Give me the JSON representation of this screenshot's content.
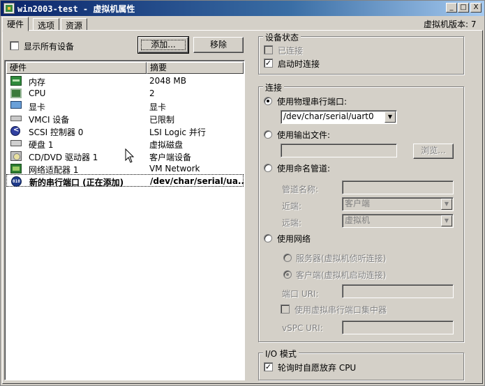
{
  "window": {
    "title": "win2003-test - 虚拟机属性",
    "minimize": "_",
    "maximize": "□",
    "close": "X"
  },
  "tabs": [
    {
      "label": "硬件",
      "active": true
    },
    {
      "label": "选项",
      "active": false
    },
    {
      "label": "资源",
      "active": false
    }
  ],
  "version_label": "虚拟机版本: 7",
  "show_all_devices": {
    "label": "显示所有设备",
    "checked": false
  },
  "buttons": {
    "add": "添加...",
    "remove": "移除",
    "browse": "浏览..."
  },
  "hardware_list": {
    "columns": [
      "硬件",
      "摘要"
    ],
    "rows": [
      {
        "icon": "memory-icon",
        "name": "内存",
        "summary": "2048 MB"
      },
      {
        "icon": "cpu-icon",
        "name": "CPU",
        "summary": "2"
      },
      {
        "icon": "display-icon",
        "name": "显卡",
        "summary": "显卡"
      },
      {
        "icon": "vmci-icon",
        "name": "VMCI 设备",
        "summary": "已限制"
      },
      {
        "icon": "scsi-controller-icon",
        "name": "SCSI 控制器 0",
        "summary": "LSI Logic 并行"
      },
      {
        "icon": "hard-disk-icon",
        "name": "硬盘 1",
        "summary": "虚拟磁盘"
      },
      {
        "icon": "cd-dvd-icon",
        "name": "CD/DVD 驱动器 1",
        "summary": "客户端设备"
      },
      {
        "icon": "network-adapter-icon",
        "name": "网络适配器 1",
        "summary": "VM Network"
      },
      {
        "icon": "serial-port-icon",
        "name": "新的串行端口 (正在添加)",
        "summary": "/dev/char/serial/ua...",
        "selected": true
      }
    ]
  },
  "device_status": {
    "title": "设备状态",
    "connected": {
      "label": "已连接",
      "checked": false,
      "enabled": false
    },
    "connect_at_power_on": {
      "label": "启动时连接",
      "checked": true,
      "enabled": true
    }
  },
  "connection": {
    "title": "连接",
    "use_physical_port": {
      "label": "使用物理串行端口:",
      "checked": true
    },
    "physical_port_value": "/dev/char/serial/uart0",
    "use_output_file": {
      "label": "使用输出文件:",
      "checked": false
    },
    "output_file_value": "",
    "use_named_pipe": {
      "label": "使用命名管道:",
      "checked": false
    },
    "pipe_name_label": "管道名称:",
    "near_end_label": "近端:",
    "near_end_value": "客户端",
    "far_end_label": "远端:",
    "far_end_value": "虚拟机",
    "use_network": {
      "label": "使用网络",
      "checked": false
    },
    "server_option": {
      "label": "服务器(虚拟机侦听连接)",
      "checked": false
    },
    "client_option": {
      "label": "客户端(虚拟机启动连接)",
      "checked": true
    },
    "port_uri_label": "端口 URI:",
    "use_vspc": {
      "label": "使用虚拟串行端口集中器",
      "checked": false
    },
    "vspc_uri_label": "vSPC URI:"
  },
  "io_mode": {
    "title": "I/O 模式",
    "yield_cpu": {
      "label": "轮询时自愿放弃 CPU",
      "checked": true
    }
  }
}
